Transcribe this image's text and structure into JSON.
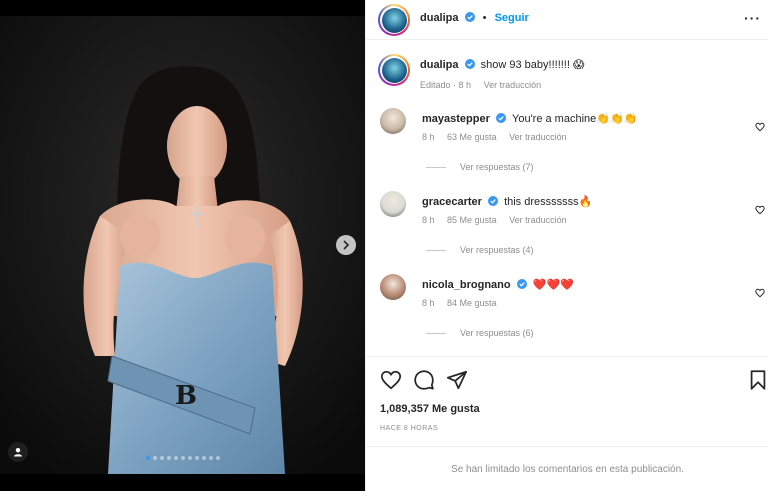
{
  "post": {
    "author": "dualipa",
    "follow_label": "Seguir",
    "follow_sep": "•",
    "more_label": "···",
    "caption_text": "show 93 baby!!!!!!! 😱",
    "caption_meta_edited": "Editado · 8 h",
    "caption_meta_translate": "Ver traducción",
    "carousel_count": 11,
    "carousel_active": 0
  },
  "comments": [
    {
      "user": "mayastepper",
      "text": "You're a machine👏👏👏",
      "time": "8 h",
      "likes": "63 Me gusta",
      "translate": "Ver traducción",
      "replies": "Ver respuestas (7)",
      "avatar_color": "#c9b9a6"
    },
    {
      "user": "gracecarter",
      "text": "this dresssssss🔥",
      "time": "8 h",
      "likes": "85 Me gusta",
      "translate": "Ver traducción",
      "replies": "Ver respuestas (4)",
      "avatar_color": "#d8dcd6"
    },
    {
      "user": "nicola_brognano",
      "text": "❤️❤️❤️",
      "time": "8 h",
      "likes": "84 Me gusta",
      "translate": "",
      "replies": "Ver respuestas (6)",
      "avatar_color": "#b88a74"
    }
  ],
  "footer": {
    "likes": "1,089,357 Me gusta",
    "time_ago": "HACE 8 HORAS",
    "limited_text": "Se han limitado los comentarios en esta publicación."
  },
  "colors": {
    "accent": "#0095f6",
    "verified": "#3897f0",
    "muted": "#8e8e8e"
  },
  "icons": [
    "heart-icon",
    "comment-icon",
    "share-icon",
    "bookmark-icon",
    "more-icon",
    "verified-icon",
    "next-arrow-icon",
    "user-tag-icon"
  ]
}
